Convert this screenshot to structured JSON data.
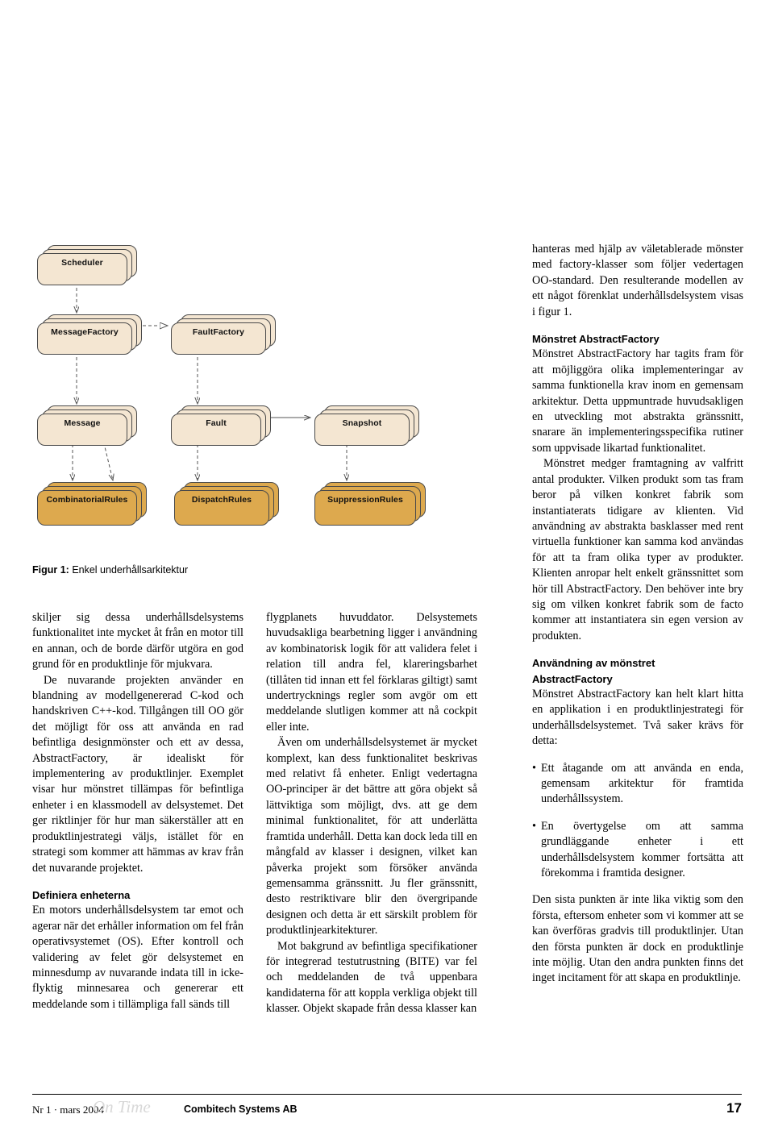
{
  "figure": {
    "caption_label": "Figur 1:",
    "caption_text": " Enkel underhållsarkitektur",
    "nodes": [
      {
        "id": "scheduler",
        "label": "Scheduler"
      },
      {
        "id": "messagefactory",
        "label": "MessageFactory"
      },
      {
        "id": "faultfactory",
        "label": "FaultFactory"
      },
      {
        "id": "message",
        "label": "Message"
      },
      {
        "id": "fault",
        "label": "Fault"
      },
      {
        "id": "snapshot",
        "label": "Snapshot"
      },
      {
        "id": "combinatorialrules",
        "label": "CombinatorialRules"
      },
      {
        "id": "dispatchrules",
        "label": "DispatchRules"
      },
      {
        "id": "suppressionrules",
        "label": "SuppressionRules"
      }
    ],
    "colors": {
      "cream": "#f4e6d2",
      "tan": "#dda94e",
      "border": "#4a4a4a"
    }
  },
  "column1": {
    "p1": "skiljer sig dessa underhållsdelsystems funktionalitet inte mycket åt från en motor till en annan, och de borde därför utgöra en god grund för en produktlinje för mjukvara.",
    "p2": "De nuvarande projekten använder en blandning av modellgenererad C-kod och handskriven C++-kod. Tillgången till OO gör det möjligt för oss att använda en rad befintliga designmönster och ett av dessa, AbstractFactory, är idealiskt för implementering av produktlinjer. Exemplet visar hur mönstret tillämpas för befintliga enheter i en klassmodell av delsystemet. Det ger riktlinjer för hur man säkerställer att en produktlinjestrategi väljs, istället för en strategi som kommer att hämmas av krav från det nuvarande projektet.",
    "h1": "Definiera enheterna",
    "p3": "En motors underhållsdelsystem tar emot och agerar när det erhåller information om fel från operativsystemet (OS). Efter kontroll och validering av felet gör delsystemet en minnesdump av nuvarande indata till in icke-flyktig minnesarea och genererar ett meddelande som i tillämpliga fall sänds till"
  },
  "column2": {
    "p1": "flygplanets huvuddator. Delsystemets huvudsakliga bearbetning ligger i användning av kombinatorisk logik för att validera felet i relation till andra fel, klareringsbarhet (tillåten tid innan ett fel förklaras giltigt) samt undertrycknings regler som avgör om ett meddelande slutligen kommer att nå cockpit eller inte.",
    "p2": "Även om underhållsdelsystemet är mycket komplext, kan dess funktionalitet beskrivas med relativt få enheter. Enligt vedertagna OO-principer är det bättre att göra objekt så lättviktiga som möjligt, dvs. att ge dem minimal funktionalitet, för att underlätta framtida underhåll. Detta kan dock leda till en mångfald av klasser i designen, vilket kan påverka projekt som försöker använda gemensamma gränssnitt. Ju fler gränssnitt, desto restriktivare blir den övergripande designen och detta är ett särskilt problem för produktlinjearkitekturer.",
    "p3": "Mot bakgrund av befintliga specifikationer för integrerad testutrustning (BITE) var fel och meddelanden de två uppenbara kandidaterna för att koppla verkliga objekt till klasser. Objekt skapade från dessa klasser kan"
  },
  "column3": {
    "p1": "hanteras med hjälp av väletablerade mönster med factory-klasser som följer vedertagen OO-standard. Den resulterande modellen av ett något förenklat underhållsdelsystem visas i figur 1.",
    "h1": "Mönstret AbstractFactory",
    "p2": "Mönstret AbstractFactory har tagits fram för att möjliggöra olika implementeringar av samma funktionella krav inom en gemensam arkitektur. Detta uppmuntrade huvudsakligen en utveckling mot abstrakta gränssnitt, snarare än implementeringsspecifika rutiner som uppvisade likartad funktionalitet.",
    "p3": "Mönstret medger framtagning av valfritt antal produkter. Vilken produkt som tas fram beror på vilken konkret fabrik som instantiaterats tidigare av klienten. Vid användning av abstrakta basklasser med rent virtuella funktioner kan samma kod användas för att ta fram olika typer av produkter. Klienten anropar helt enkelt gränssnittet som hör till AbstractFactory. Den behöver inte bry sig om vilken konkret fabrik som de facto kommer att instantiatera sin egen version av produkten.",
    "h2_line1": "Användning av mönstret",
    "h2_line2": "AbstractFactory",
    "p4": "Mönstret AbstractFactory kan helt klart hitta en applikation i en produktlinjestrategi för underhållsdelsystemet. Två saker krävs för detta:",
    "bullet1": "Ett åtagande om att använda en enda, gemensam arkitektur för framtida underhållssystem.",
    "bullet2": "En övertygelse om att samma grundläggande enheter i ett underhållsdelsystem kommer fortsätta att förekomma i framtida designer.",
    "p5": "Den sista punkten är inte lika viktig som den första, eftersom enheter som vi kommer att se kan överföras gradvis till produktlinjer. Utan den första punkten är dock en produktlinje inte möjlig. Utan den andra punkten finns det inget incitament för att skapa en produktlinje.",
    "bullet_glyph": "•"
  },
  "footer": {
    "issue": "Nr 1 · mars 2004",
    "logo": "On Time",
    "company": "Combitech Systems AB",
    "page": "17"
  }
}
